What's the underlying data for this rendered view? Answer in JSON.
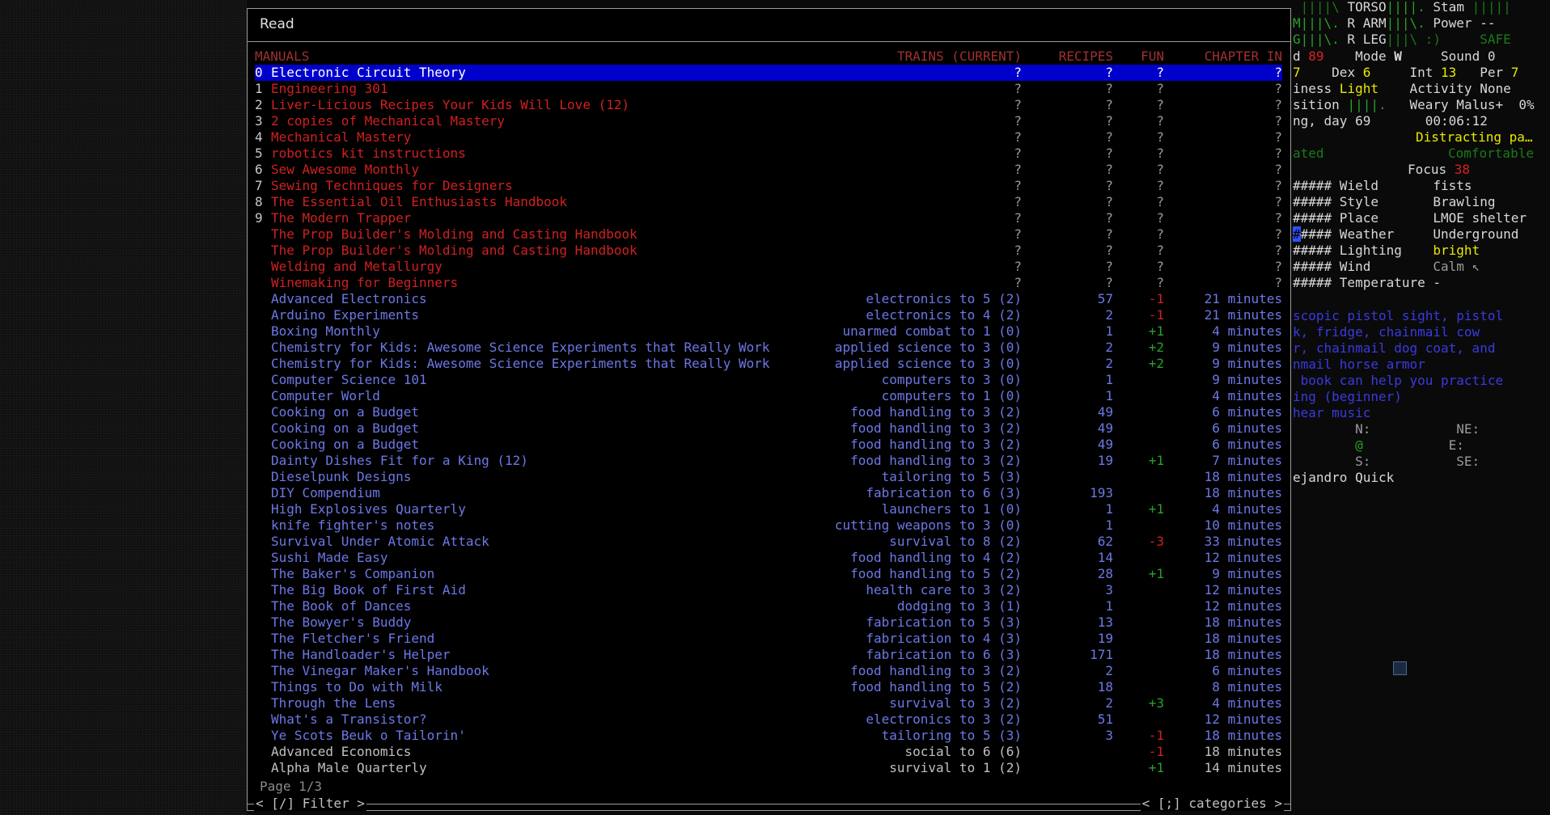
{
  "dialog": {
    "title": "Read",
    "headers": {
      "manuals": "MANUALS",
      "trains": "TRAINS (CURRENT)",
      "recipes": "RECIPES",
      "fun": "FUN",
      "chapter": "CHAPTER IN"
    },
    "page": "Page 1/3",
    "filter_label": "< [/] Filter >",
    "categories_label": "< [;] categories >"
  },
  "books": [
    {
      "idx": "0",
      "name": "Electronic Circuit Theory",
      "trains": "?",
      "recipes": "?",
      "fun": "?",
      "time": "?",
      "color": "selected"
    },
    {
      "idx": "1",
      "name": "Engineering 301",
      "trains": "?",
      "recipes": "?",
      "fun": "?",
      "time": "?",
      "color": "red"
    },
    {
      "idx": "2",
      "name": "Liver-Licious Recipes Your Kids Will Love (12)",
      "trains": "?",
      "recipes": "?",
      "fun": "?",
      "time": "?",
      "color": "red"
    },
    {
      "idx": "3",
      "name": "2 copies of Mechanical Mastery",
      "trains": "?",
      "recipes": "?",
      "fun": "?",
      "time": "?",
      "color": "red"
    },
    {
      "idx": "4",
      "name": "Mechanical Mastery",
      "trains": "?",
      "recipes": "?",
      "fun": "?",
      "time": "?",
      "color": "red"
    },
    {
      "idx": "5",
      "name": "robotics kit instructions",
      "trains": "?",
      "recipes": "?",
      "fun": "?",
      "time": "?",
      "color": "red"
    },
    {
      "idx": "6",
      "name": "Sew Awesome Monthly",
      "trains": "?",
      "recipes": "?",
      "fun": "?",
      "time": "?",
      "color": "red"
    },
    {
      "idx": "7",
      "name": "Sewing Techniques for Designers",
      "trains": "?",
      "recipes": "?",
      "fun": "?",
      "time": "?",
      "color": "red"
    },
    {
      "idx": "8",
      "name": "The Essential Oil Enthusiasts Handbook",
      "trains": "?",
      "recipes": "?",
      "fun": "?",
      "time": "?",
      "color": "red"
    },
    {
      "idx": "9",
      "name": "The Modern Trapper",
      "trains": "?",
      "recipes": "?",
      "fun": "?",
      "time": "?",
      "color": "red"
    },
    {
      "idx": "",
      "name": "The Prop Builder's Molding and Casting Handbook",
      "trains": "?",
      "recipes": "?",
      "fun": "?",
      "time": "?",
      "color": "red"
    },
    {
      "idx": "",
      "name": "The Prop Builder's Molding and Casting Handbook",
      "trains": "?",
      "recipes": "?",
      "fun": "?",
      "time": "?",
      "color": "red"
    },
    {
      "idx": "",
      "name": "Welding and Metallurgy",
      "trains": "?",
      "recipes": "?",
      "fun": "?",
      "time": "?",
      "color": "red"
    },
    {
      "idx": "",
      "name": "Winemaking for Beginners",
      "trains": "?",
      "recipes": "?",
      "fun": "?",
      "time": "?",
      "color": "red"
    },
    {
      "idx": "",
      "name": "Advanced Electronics",
      "trains": "electronics to 5 (2)",
      "recipes": "57",
      "fun": "-1",
      "time": "21 minutes",
      "color": "blue"
    },
    {
      "idx": "",
      "name": "Arduino Experiments",
      "trains": "electronics to 4 (2)",
      "recipes": "2",
      "fun": "-1",
      "time": "21 minutes",
      "color": "blue"
    },
    {
      "idx": "",
      "name": "Boxing Monthly",
      "trains": "unarmed combat to 1 (0)",
      "recipes": "1",
      "fun": "+1",
      "time": "4 minutes",
      "color": "blue"
    },
    {
      "idx": "",
      "name": "Chemistry for Kids: Awesome Science Experiments that Really Work",
      "trains": "applied science to 3 (0)",
      "recipes": "2",
      "fun": "+2",
      "time": "9 minutes",
      "color": "blue"
    },
    {
      "idx": "",
      "name": "Chemistry for Kids: Awesome Science Experiments that Really Work",
      "trains": "applied science to 3 (0)",
      "recipes": "2",
      "fun": "+2",
      "time": "9 minutes",
      "color": "blue"
    },
    {
      "idx": "",
      "name": "Computer Science 101",
      "trains": "computers to 3 (0)",
      "recipes": "1",
      "fun": "",
      "time": "9 minutes",
      "color": "blue"
    },
    {
      "idx": "",
      "name": "Computer World",
      "trains": "computers to 1 (0)",
      "recipes": "1",
      "fun": "",
      "time": "4 minutes",
      "color": "blue"
    },
    {
      "idx": "",
      "name": "Cooking on a Budget",
      "trains": "food handling to 3 (2)",
      "recipes": "49",
      "fun": "",
      "time": "6 minutes",
      "color": "blue"
    },
    {
      "idx": "",
      "name": "Cooking on a Budget",
      "trains": "food handling to 3 (2)",
      "recipes": "49",
      "fun": "",
      "time": "6 minutes",
      "color": "blue"
    },
    {
      "idx": "",
      "name": "Cooking on a Budget",
      "trains": "food handling to 3 (2)",
      "recipes": "49",
      "fun": "",
      "time": "6 minutes",
      "color": "blue"
    },
    {
      "idx": "",
      "name": "Dainty Dishes Fit for a King (12)",
      "trains": "food handling to 3 (2)",
      "recipes": "19",
      "fun": "+1",
      "time": "7 minutes",
      "color": "blue"
    },
    {
      "idx": "",
      "name": "Dieselpunk Designs",
      "trains": "tailoring to 5 (3)",
      "recipes": "",
      "fun": "",
      "time": "18 minutes",
      "color": "blue"
    },
    {
      "idx": "",
      "name": "DIY Compendium",
      "trains": "fabrication to 6 (3)",
      "recipes": "193",
      "fun": "",
      "time": "18 minutes",
      "color": "blue"
    },
    {
      "idx": "",
      "name": "High Explosives Quarterly",
      "trains": "launchers to 1 (0)",
      "recipes": "1",
      "fun": "+1",
      "time": "4 minutes",
      "color": "blue"
    },
    {
      "idx": "",
      "name": "knife fighter's notes",
      "trains": "cutting weapons to 3 (0)",
      "recipes": "1",
      "fun": "",
      "time": "10 minutes",
      "color": "blue"
    },
    {
      "idx": "",
      "name": "Survival Under Atomic Attack",
      "trains": "survival to 8 (2)",
      "recipes": "62",
      "fun": "-3",
      "time": "33 minutes",
      "color": "blue"
    },
    {
      "idx": "",
      "name": "Sushi Made Easy",
      "trains": "food handling to 4 (2)",
      "recipes": "14",
      "fun": "",
      "time": "12 minutes",
      "color": "blue"
    },
    {
      "idx": "",
      "name": "The Baker's Companion",
      "trains": "food handling to 5 (2)",
      "recipes": "28",
      "fun": "+1",
      "time": "9 minutes",
      "color": "blue"
    },
    {
      "idx": "",
      "name": "The Big Book of First Aid",
      "trains": "health care to 3 (2)",
      "recipes": "3",
      "fun": "",
      "time": "12 minutes",
      "color": "blue"
    },
    {
      "idx": "",
      "name": "The Book of Dances",
      "trains": "dodging to 3 (1)",
      "recipes": "1",
      "fun": "",
      "time": "12 minutes",
      "color": "blue"
    },
    {
      "idx": "",
      "name": "The Bowyer's Buddy",
      "trains": "fabrication to 5 (3)",
      "recipes": "13",
      "fun": "",
      "time": "18 minutes",
      "color": "blue"
    },
    {
      "idx": "",
      "name": "The Fletcher's Friend",
      "trains": "fabrication to 4 (3)",
      "recipes": "19",
      "fun": "",
      "time": "18 minutes",
      "color": "blue"
    },
    {
      "idx": "",
      "name": "The Handloader's Helper",
      "trains": "fabrication to 6 (3)",
      "recipes": "171",
      "fun": "",
      "time": "18 minutes",
      "color": "blue"
    },
    {
      "idx": "",
      "name": "The Vinegar Maker's Handbook",
      "trains": "food handling to 3 (2)",
      "recipes": "2",
      "fun": "",
      "time": "6 minutes",
      "color": "blue"
    },
    {
      "idx": "",
      "name": "Things to Do with Milk",
      "trains": "food handling to 5 (2)",
      "recipes": "18",
      "fun": "",
      "time": "8 minutes",
      "color": "blue"
    },
    {
      "idx": "",
      "name": "Through the Lens",
      "trains": "survival to 3 (2)",
      "recipes": "2",
      "fun": "+3",
      "time": "4 minutes",
      "color": "blue"
    },
    {
      "idx": "",
      "name": "What's a Transistor?",
      "trains": "electronics to 3 (2)",
      "recipes": "51",
      "fun": "",
      "time": "12 minutes",
      "color": "blue"
    },
    {
      "idx": "",
      "name": "Ye Scots Beuk o Tailorin'",
      "trains": "tailoring to 5 (3)",
      "recipes": "3",
      "fun": "-1",
      "time": "18 minutes",
      "color": "blue"
    },
    {
      "idx": "",
      "name": "Advanced Economics",
      "trains": "social to 6 (6)",
      "recipes": "",
      "fun": "-1",
      "time": "18 minutes",
      "color": "grey"
    },
    {
      "idx": "",
      "name": "Alpha Male Quarterly",
      "trains": "survival to 1 (2)",
      "recipes": "",
      "fun": "+1",
      "time": "14 minutes",
      "color": "grey"
    }
  ],
  "sidebar": {
    "l1a": " ||||\\ ",
    "l1b": "TORSO",
    "l1c": "||||.",
    "l1d": " Stam ",
    "l1e": "|||||",
    "l2a": "M|||\\.",
    "l2b": " R ARM",
    "l2c": "|||\\.",
    "l2d": " Power --",
    "l3a": "G|||\\.",
    "l3b": " R LEG",
    "l3c": "|||\\ :)",
    "l3d": "     SAFE",
    "l4a": "d ",
    "l4b": "89",
    "l4c": "    Mode ",
    "l4d": "W",
    "l4e": "     Sound 0",
    "l5a": "7",
    "l5b": "    Dex ",
    "l5c": "6",
    "l5d": "     Int ",
    "l5e": "13",
    "l5f": "   Per ",
    "l5g": "7",
    "l6a": "iness ",
    "l6b": "Light",
    "l6c": "    Activity None",
    "l7a": "sition ",
    "l7b": "||||.",
    "l7c": "   Weary Malus+  0%",
    "l8a": "ng, day 69       00:06:12",
    "l9a": "Distracting pa…",
    "l10a": "ated",
    "l10b": "Comfortable",
    "l11a": "Focus ",
    "l11b": "38",
    "l12": "##### Wield       fists",
    "l13": "##### Style       Brawling",
    "l14": "##### Place       LMOE shelter",
    "l15a": "#",
    "l15b": "#### Weather     Underground",
    "l16a": "##### Lighting    ",
    "l16b": "bright",
    "l17a": "##### Wind        ",
    "l17b": "Calm ↖",
    "l18": "##### Temperature -",
    "m1": "scopic pistol sight, pistol",
    "m2": "k, fridge, chainmail cow",
    "m3": "r, chainmail dog coat, and",
    "m4": "nmail horse armor",
    "m5": " book can help you practice",
    "m6": "ing (beginner)",
    "m7": "hear music",
    "c1a": "        N:",
    "c1b": "           NE:",
    "c2a": "        ",
    "c2b": "@",
    "c2c": "           E:",
    "c3a": "        S:",
    "c3b": "           SE:",
    "who": "ejandro Quick"
  }
}
